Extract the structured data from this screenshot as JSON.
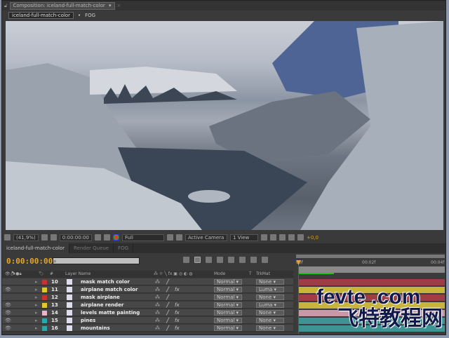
{
  "comp_panel": {
    "title": "Composition: iceland-full-match-color",
    "breadcrumbs": [
      "iceland-full-match-color",
      "FOG"
    ]
  },
  "viewer_toolbar": {
    "zoom": "(41,9%)",
    "timecode": "0:00:00:00",
    "resolution": "Full",
    "camera": "Active Camera",
    "views": "1 View",
    "exposure": "+0,0"
  },
  "timeline": {
    "tabs": [
      "iceland-full-match-color",
      "Render Queue",
      "FOG"
    ],
    "current_time": "0:00:00:00",
    "ruler": [
      "00f",
      "00:02f",
      "00:04f"
    ],
    "headers": {
      "num": "#",
      "layer_name": "Layer Name",
      "mode": "Mode",
      "t": "T",
      "trkmat": "TrkMat"
    },
    "layers": [
      {
        "num": "10",
        "name": "mask match color",
        "mode": "Normal",
        "trkmat": "None",
        "color": "#c83232",
        "bar": "#a03c46",
        "visible": false,
        "fx": false
      },
      {
        "num": "11",
        "name": "airplane match color",
        "mode": "Normal",
        "trkmat": "Luma",
        "color": "#e0c828",
        "bar": "#c8b43c",
        "visible": true,
        "fx": true
      },
      {
        "num": "12",
        "name": "mask airplane",
        "mode": "Normal",
        "trkmat": "None",
        "color": "#c83232",
        "bar": "#a03c46",
        "visible": false,
        "fx": false
      },
      {
        "num": "13",
        "name": "airplane render",
        "mode": "Normal",
        "trkmat": "Luma",
        "color": "#e0c828",
        "bar": "#c8b43c",
        "visible": true,
        "fx": true
      },
      {
        "num": "14",
        "name": "levels matte painting",
        "mode": "Normal",
        "trkmat": "None",
        "color": "#e8b4c8",
        "bar": "#c89aa8",
        "visible": true,
        "fx": true
      },
      {
        "num": "15",
        "name": "pines",
        "mode": "Normal",
        "trkmat": "None",
        "color": "#28a8a8",
        "bar": "#3c9494",
        "visible": true,
        "fx": true
      },
      {
        "num": "16",
        "name": "mountains",
        "mode": "Normal",
        "trkmat": "None",
        "color": "#28a8a8",
        "bar": "#3c9494",
        "visible": true,
        "fx": true
      }
    ]
  },
  "watermark": {
    "line1": "fevte .com",
    "line2": "飞特教程网"
  }
}
